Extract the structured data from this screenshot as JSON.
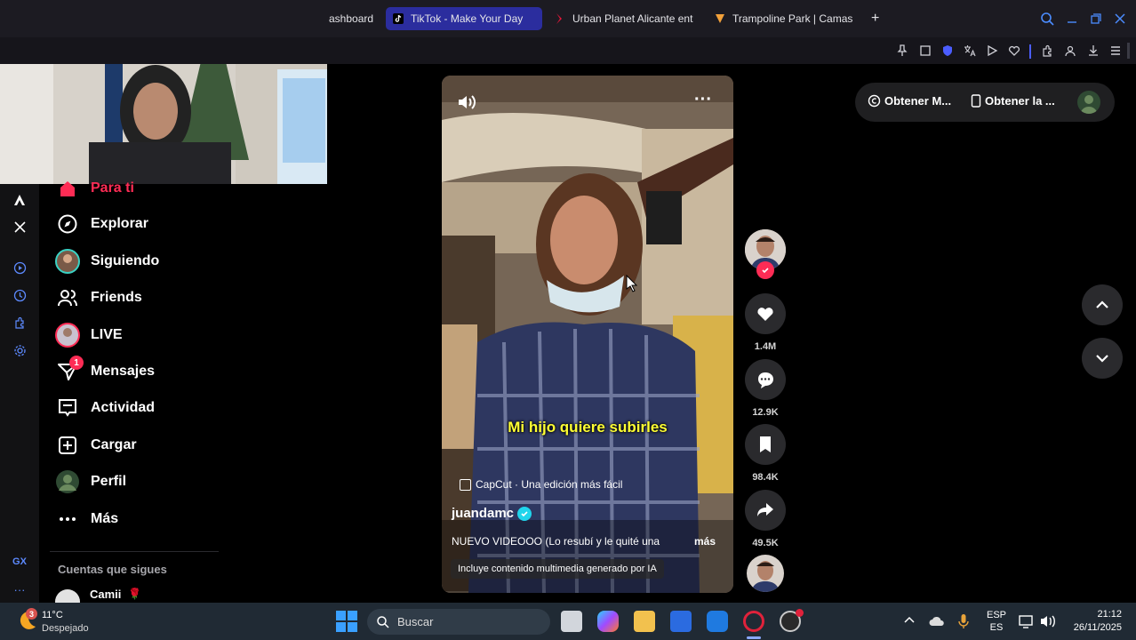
{
  "browser": {
    "tabs": [
      {
        "label": "ashboard",
        "active": false
      },
      {
        "label": "TikTok - Make Your Day",
        "active": true
      },
      {
        "label": "Urban Planet Alicante ent",
        "active": false
      },
      {
        "label": "Trampoline Park | Camas",
        "active": false
      }
    ],
    "new_tab": "+"
  },
  "sidebar": {
    "items": [
      {
        "label": "Para ti",
        "icon": "home-icon"
      },
      {
        "label": "Explorar",
        "icon": "compass-icon"
      },
      {
        "label": "Siguiendo",
        "icon": "avatar-icon"
      },
      {
        "label": "Friends",
        "icon": "friends-icon"
      },
      {
        "label": "LIVE",
        "icon": "avatar-icon"
      },
      {
        "label": "Mensajes",
        "icon": "send-icon",
        "badge": "1"
      },
      {
        "label": "Actividad",
        "icon": "inbox-icon"
      },
      {
        "label": "Cargar",
        "icon": "plus-square-icon"
      },
      {
        "label": "Perfil",
        "icon": "avatar-icon"
      },
      {
        "label": "Más",
        "icon": "more-icon"
      }
    ],
    "following_header": "Cuentas que sigues",
    "following": [
      {
        "name": "Camii",
        "emoji": "🌹"
      }
    ]
  },
  "video": {
    "caption_overlay": "Mi hijo quiere subirles",
    "capcut_label": "CapCut · Una edición más fácil",
    "username": "juandamc",
    "description": "NUEVO VIDEOOO (Lo resubí y le quité una",
    "more": "más",
    "ai_notice": "Incluye contenido multimedia generado por IA"
  },
  "actions": {
    "likes": "1.4M",
    "comments": "12.9K",
    "saves": "98.4K",
    "shares": "49.5K"
  },
  "top_buttons": {
    "get_coins": "Obtener M...",
    "get_app": "Obtener la ..."
  },
  "taskbar": {
    "weather_temp": "11°C",
    "weather_desc": "Despejado",
    "weather_badge": "3",
    "search": "Buscar",
    "lang_top": "ESP",
    "lang_bottom": "ES",
    "time": "21:12",
    "date": "26/11/2025"
  },
  "colors": {
    "tiktok_red": "#fe2c55",
    "active_tab": "#2b2d9e",
    "caption_yellow": "#ffff33",
    "taskbar": "#202a34"
  }
}
